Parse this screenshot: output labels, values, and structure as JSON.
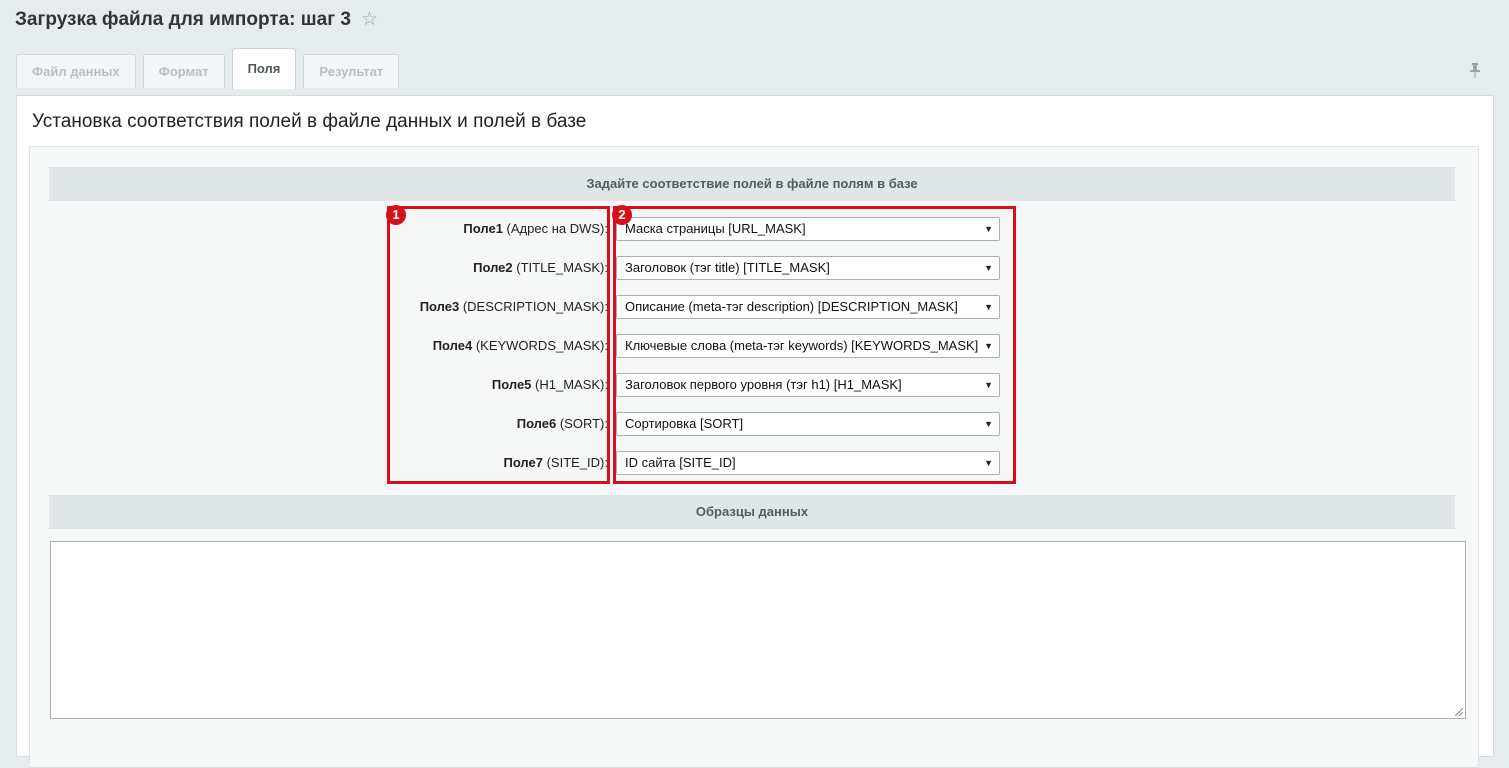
{
  "header": {
    "title": "Загрузка файла для импорта: шаг 3"
  },
  "tabs": [
    {
      "label": "Файл данных"
    },
    {
      "label": "Формат"
    },
    {
      "label": "Поля"
    },
    {
      "label": "Результат"
    }
  ],
  "panel": {
    "heading": "Установка соответствия полей в файле данных и полей в базе",
    "mapping_section_title": "Задайте соответствие полей в файле полям в базе",
    "samples_section_title": "Образцы данных",
    "badges": [
      "1",
      "2"
    ]
  },
  "fields": [
    {
      "name": "Поле1",
      "desc": " (Адрес на DWS):",
      "value": "Маска страницы [URL_MASK]"
    },
    {
      "name": "Поле2",
      "desc": " (TITLE_MASK):",
      "value": "Заголовок (тэг title) [TITLE_MASK]"
    },
    {
      "name": "Поле3",
      "desc": " (DESCRIPTION_MASK):",
      "value": "Описание (meta-тэг description) [DESCRIPTION_MASK]"
    },
    {
      "name": "Поле4",
      "desc": " (KEYWORDS_MASK):",
      "value": "Ключевые слова (meta-тэг keywords) [KEYWORDS_MASK]"
    },
    {
      "name": "Поле5",
      "desc": " (H1_MASK):",
      "value": "Заголовок первого уровня (тэг h1) [H1_MASK]"
    },
    {
      "name": "Поле6",
      "desc": " (SORT):",
      "value": "Сортировка [SORT]"
    },
    {
      "name": "Поле7",
      "desc": " (SITE_ID):",
      "value": "ID сайта [SITE_ID]"
    }
  ],
  "icons": {
    "star": "star-icon",
    "pin": "pin-icon",
    "dropdown": "chevron-down-icon"
  },
  "colors": {
    "highlight": "#d7101e",
    "background": "#e6eced"
  }
}
